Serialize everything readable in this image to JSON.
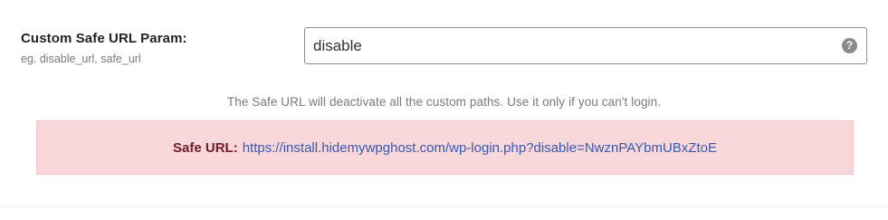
{
  "field": {
    "label": "Custom Safe URL Param:",
    "hint": "eg. disable_url, safe_url",
    "value": "disable",
    "help_glyph": "?"
  },
  "notice": "The Safe URL will deactivate all the custom paths. Use it only if you can't login.",
  "safe_url": {
    "label": "Safe URL:",
    "link": "https://install.hidemywpghost.com/wp-login.php?disable=NwznPAYbmUBxZtoE"
  },
  "colors": {
    "alert_bg": "#f8d7da",
    "alert_label": "#721c24",
    "link": "#3859b0"
  },
  "icons": [
    "help-icon"
  ]
}
